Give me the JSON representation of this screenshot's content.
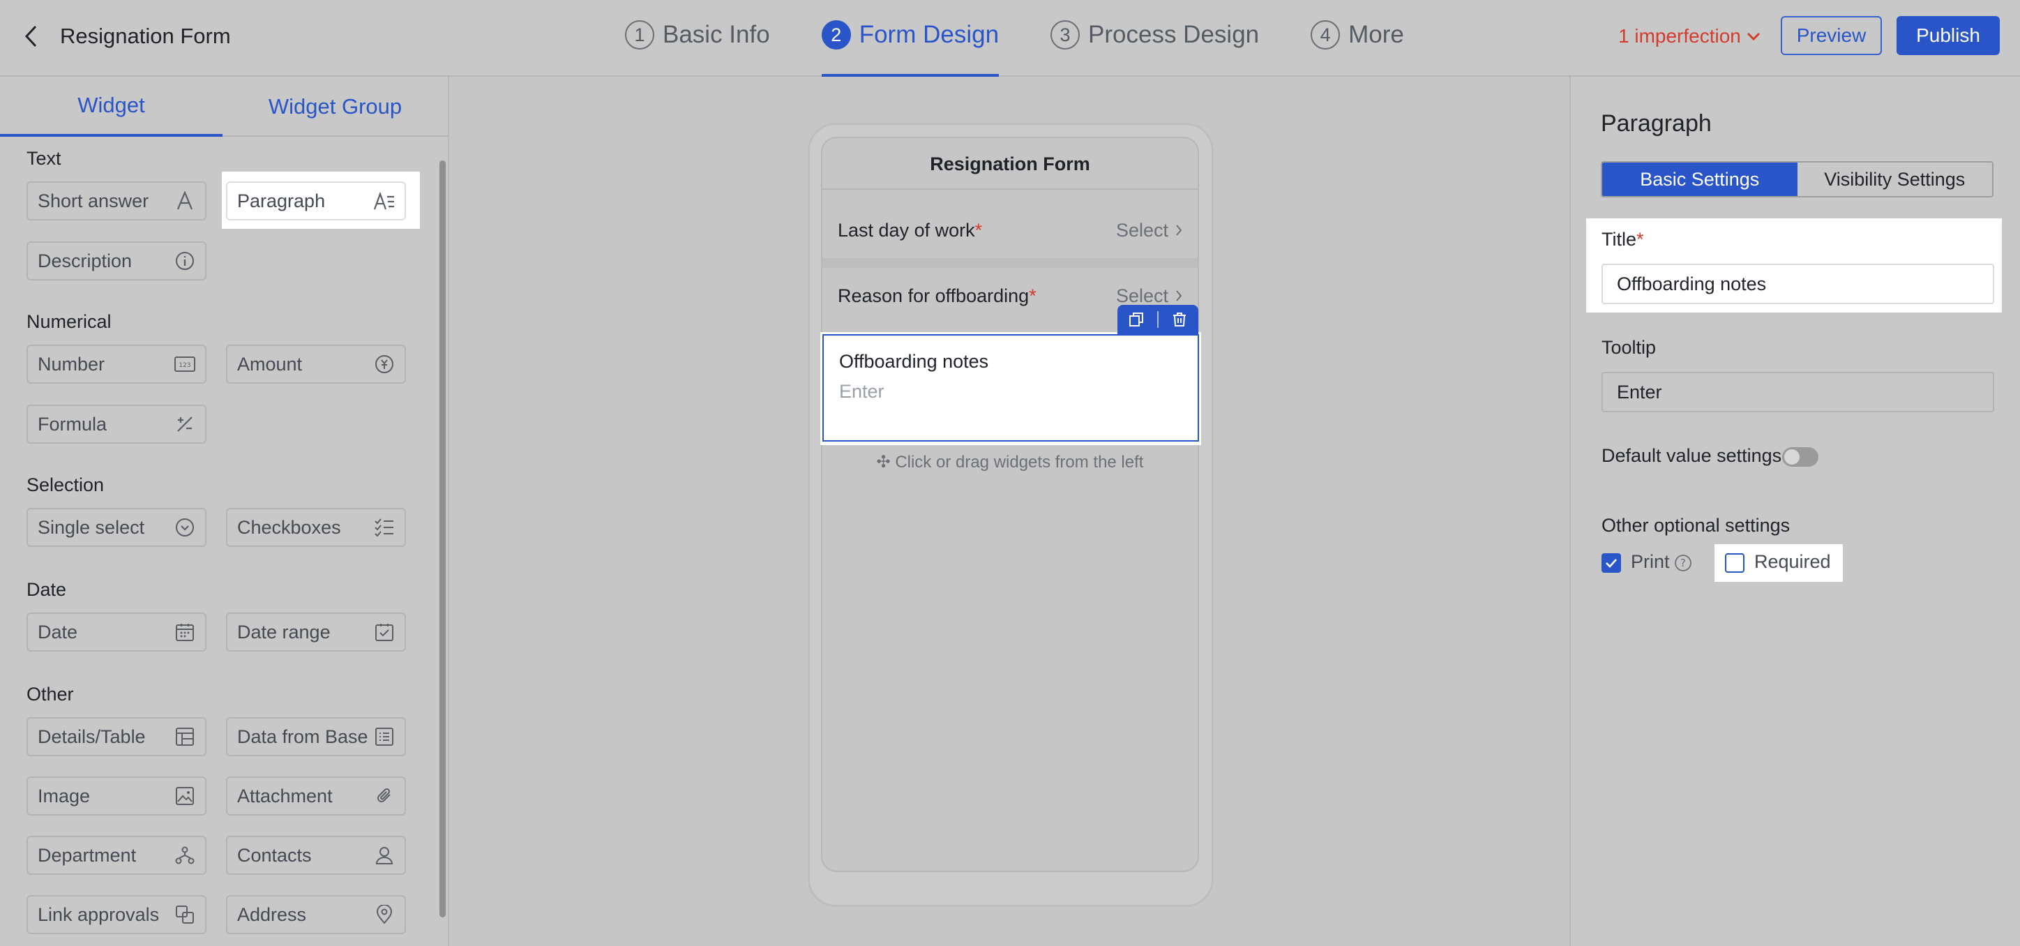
{
  "header": {
    "title": "Resignation Form",
    "steps": [
      {
        "num": "1",
        "label": "Basic Info"
      },
      {
        "num": "2",
        "label": "Form Design"
      },
      {
        "num": "3",
        "label": "Process Design"
      },
      {
        "num": "4",
        "label": "More"
      }
    ],
    "imperfection": "1 imperfection",
    "preview": "Preview",
    "publish": "Publish"
  },
  "left": {
    "tabs": [
      "Widget",
      "Widget Group"
    ],
    "groups": {
      "text": "Text",
      "numerical": "Numerical",
      "selection": "Selection",
      "date": "Date",
      "other": "Other"
    },
    "widgets": {
      "short_answer": "Short answer",
      "paragraph": "Paragraph",
      "description": "Description",
      "number": "Number",
      "amount": "Amount",
      "formula": "Formula",
      "single_select": "Single select",
      "checkboxes": "Checkboxes",
      "date": "Date",
      "date_range": "Date range",
      "details_table": "Details/Table",
      "data_from_base": "Data from Base",
      "image": "Image",
      "attachment": "Attachment",
      "department": "Department",
      "contacts": "Contacts",
      "link_approvals": "Link approvals",
      "address": "Address"
    }
  },
  "canvas": {
    "form_title": "Resignation Form",
    "fields": [
      {
        "label": "Last day of work",
        "value": "Select"
      },
      {
        "label": "Reason for offboarding",
        "value": "Select"
      }
    ],
    "required_mark": "*",
    "selected": {
      "title": "Offboarding notes",
      "placeholder": "Enter"
    },
    "hint": "Click or drag widgets from the left"
  },
  "right": {
    "title": "Paragraph",
    "tabs": [
      "Basic Settings",
      "Visibility Settings"
    ],
    "title_label": "Title",
    "title_value": "Offboarding notes",
    "tooltip_label": "Tooltip",
    "tooltip_value": "Enter",
    "default_value_label": "Default value settings",
    "other_label": "Other optional settings",
    "print_label": "Print",
    "required_label": "Required"
  },
  "colors": {
    "accent": "#2a55c8",
    "error": "#d23c2f"
  }
}
